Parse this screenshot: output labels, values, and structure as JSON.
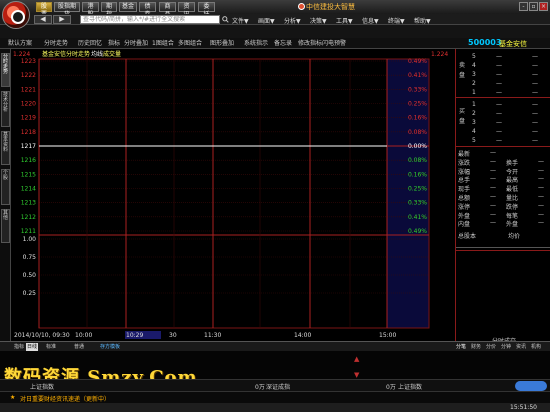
{
  "titlebar": {
    "buttons": [
      "股票",
      "股指期货",
      "港股",
      "期指",
      "基金",
      "债券",
      "商品",
      "资讯",
      "委托"
    ],
    "app_title": "中信建投大智慧",
    "winbtns": [
      "-",
      "▫",
      "×"
    ]
  },
  "toolbar": {
    "search_placeholder": "查寻代码/简拼，输入*/#进行全文搜索",
    "menus": [
      "文件▼",
      "画面▼",
      "分析▼",
      "决策▼",
      "工具▼",
      "信息▼",
      "终端▼",
      "帮助▼"
    ]
  },
  "tabs": [
    "默认方案",
    "分时走势",
    "历史回忆",
    "指标",
    "分时叠加",
    "1图组合",
    "多图组合",
    "图形叠加",
    "系统指示",
    "备忘录",
    "修改指标",
    "闪电预警"
  ],
  "quote": {
    "code": "500003",
    "name": "基金安信"
  },
  "vtabs": [
    "分时走势",
    "技术分析",
    "基本资料",
    "个股",
    "其他"
  ],
  "chart_data": {
    "type": "line",
    "header_left": "1.224",
    "header_right": "1.224",
    "header_text": "基金安信分时走势",
    "header_sub1": "均线",
    "header_sub2": "成交量",
    "price_ticks": [
      "1223",
      "1222",
      "1221",
      "1220",
      "1219",
      "1218",
      "1217",
      "1216",
      "1215",
      "1214",
      "1213",
      "1212",
      "1211",
      "1.00",
      "0.75",
      "0.50",
      "0.25"
    ],
    "pct_ticks": [
      "0.49%",
      "0.41%",
      "0.33%",
      "0.25%",
      "0.16%",
      "0.08%",
      "0.00%",
      "0.08%",
      "0.16%",
      "0.25%",
      "0.33%",
      "0.41%",
      "0.49%"
    ],
    "prev_close": "1217",
    "time_ticks": [
      "2014/10/10, 09:30",
      "10:00",
      "10:29",
      "30",
      "11:30",
      "14:00",
      "15:00"
    ],
    "series": [
      {
        "values": [
          1217,
          1217,
          1217,
          1217,
          1217,
          1217
        ]
      }
    ]
  },
  "orderbook": {
    "sell": [
      "5",
      "4",
      "3",
      "2",
      "1"
    ],
    "buy": [
      "1",
      "2",
      "3",
      "4",
      "5"
    ],
    "sell_label": "卖盘",
    "buy_label": "买盘",
    "dash": "—"
  },
  "stats": {
    "left": [
      "最新",
      "涨跌",
      "涨幅",
      "总手",
      "现手",
      "总额",
      "涨停",
      "外盘",
      "内盘"
    ],
    "right": [
      "换手",
      "今开",
      "最高",
      "最低",
      "量比",
      "跌停",
      "每笔",
      "外盘"
    ],
    "bottom": [
      "总股本",
      "均价"
    ]
  },
  "rp_tab": "分时成交",
  "bottom_tabs": [
    "指标",
    "日线",
    "标准",
    "普通",
    "存方模板"
  ],
  "ticker": {
    "item1": "上证指数",
    "item2": "0万",
    "item3": "深证成指",
    "item4": "0万",
    "item5": "上证指数",
    "news": "对日重要财经资讯速递（更新中）"
  },
  "rp_bottom_tabs": [
    "分笔",
    "财务",
    "分价",
    "分钟",
    "资讯",
    "机构"
  ],
  "clock": "15:51:50",
  "watermark": "数码资源 Smzy.Com"
}
